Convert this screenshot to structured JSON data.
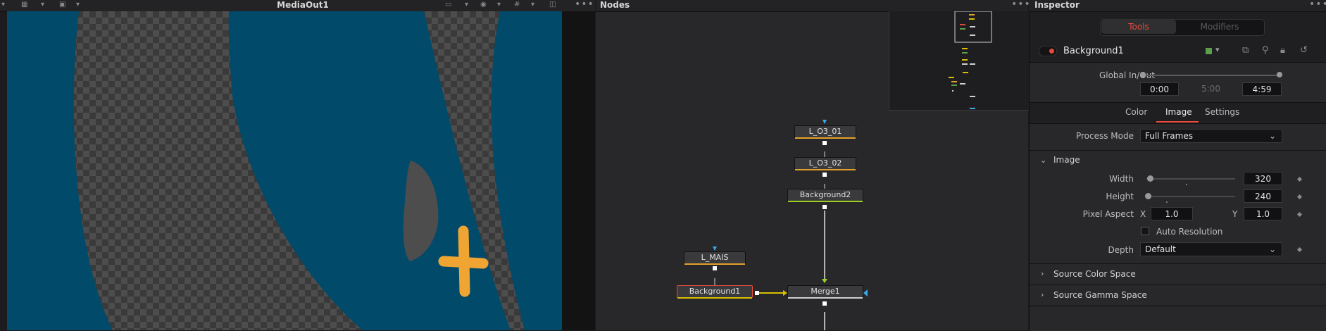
{
  "viewer": {
    "title": "MediaOut1"
  },
  "nodes_panel": {
    "title": "Nodes"
  },
  "nodes": {
    "l_o3_01": "L_O3_01",
    "l_o3_02": "L_O3_02",
    "background2": "Background2",
    "l_mais": "L_MAIS",
    "background1": "Background1",
    "merge1": "Merge1"
  },
  "inspector": {
    "title": "Inspector",
    "tabs": {
      "tools": "Tools",
      "modifiers": "Modifiers"
    },
    "tool_name": "Background1",
    "global_inout": {
      "label": "Global In/Out",
      "start": "0:00",
      "mid": "5:00",
      "end": "4:59"
    },
    "subtabs": {
      "color": "Color",
      "image": "Image",
      "settings": "Settings"
    },
    "process_mode": {
      "label": "Process Mode",
      "value": "Full Frames"
    },
    "image_section": {
      "title": "Image",
      "width": {
        "label": "Width",
        "value": "320"
      },
      "height": {
        "label": "Height",
        "value": "240"
      },
      "pixel_aspect": {
        "label": "Pixel Aspect",
        "x_label": "X",
        "x_value": "1.0",
        "y_label": "Y",
        "y_value": "1.0"
      },
      "auto_resolution": {
        "label": "Auto Resolution",
        "checked": false
      },
      "depth": {
        "label": "Depth",
        "value": "Default"
      }
    },
    "source_color_space": "Source Color Space",
    "source_gamma_space": "Source Gamma Space"
  },
  "colors": {
    "accent_red": "#e64b3c",
    "viewer_blue": "#024a6a",
    "cross_orange": "#f0a533",
    "node_link_yellow": "#d8c000"
  }
}
